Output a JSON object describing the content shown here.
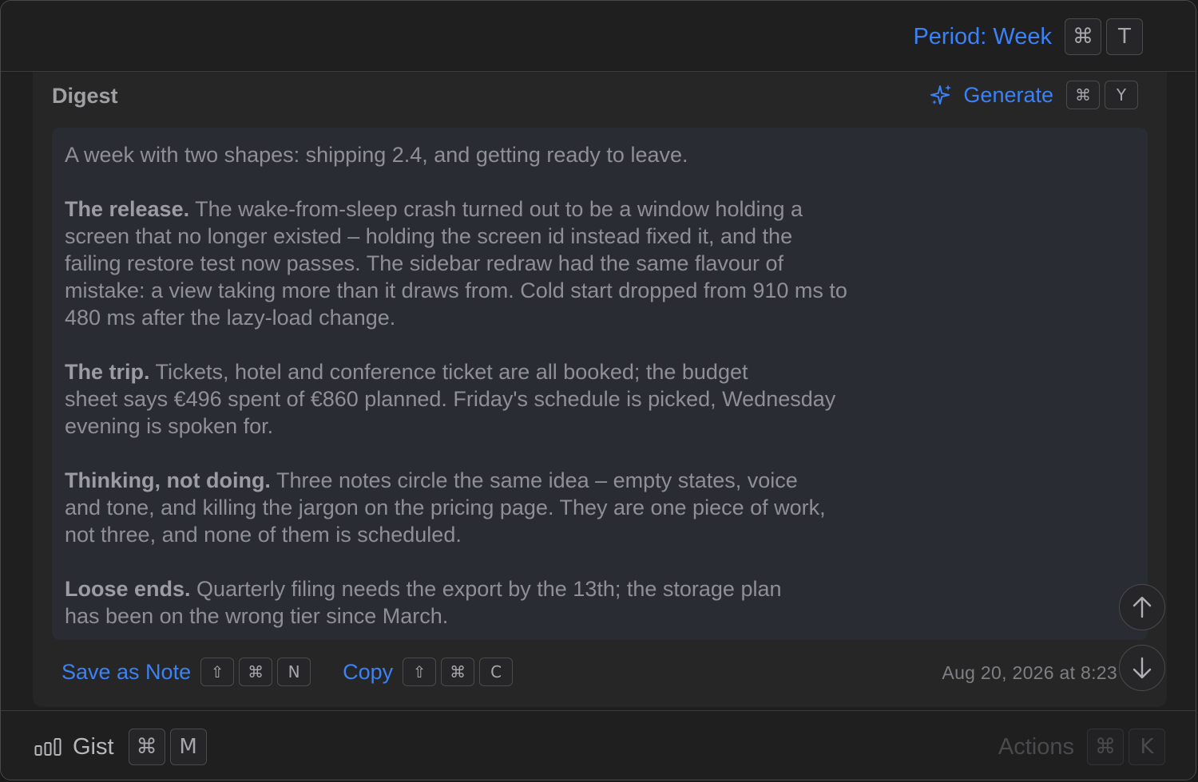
{
  "header": {
    "period_label": "Period: Week",
    "period_keys": [
      "⌘",
      "T"
    ]
  },
  "digest": {
    "title": "Digest",
    "generate_label": "Generate",
    "generate_keys": [
      "⌘",
      "Y"
    ],
    "intro": "A week with two shapes: shipping 2.4, and getting ready to leave.",
    "sections": [
      {
        "heading": "The release.",
        "lines": [
          "The wake-from-sleep crash turned out to be a window holding a",
          "screen that no longer existed – holding the screen id instead fixed it, and the",
          "failing restore test now passes. The sidebar redraw had the same flavour of",
          "mistake: a view taking more than it draws from. Cold start dropped from 910 ms to",
          "480 ms after the lazy-load change."
        ]
      },
      {
        "heading": "The trip.",
        "lines": [
          "Tickets, hotel and conference ticket are all booked; the budget",
          "sheet says €496 spent of €860 planned. Friday's schedule is picked, Wednesday",
          "evening is spoken for."
        ]
      },
      {
        "heading": "Thinking, not doing.",
        "lines": [
          "Three notes circle the same idea – empty states, voice",
          "and tone, and killing the jargon on the pricing page. They are one piece of work,",
          "not three, and none of them is scheduled."
        ]
      },
      {
        "heading": "Loose ends.",
        "lines": [
          "Quarterly filing needs the export by the 13th; the storage plan",
          "has been on the wrong tier since March."
        ]
      }
    ],
    "save_label": "Save as Note",
    "save_keys": [
      "⇧",
      "⌘",
      "N"
    ],
    "copy_label": "Copy",
    "copy_keys": [
      "⇧",
      "⌘",
      "C"
    ],
    "timestamp": "Aug 20, 2026 at 8:23"
  },
  "bottom": {
    "gist_label": "Gist",
    "gist_keys": [
      "⌘",
      "M"
    ],
    "actions_label": "Actions",
    "actions_keys": [
      "⌘",
      "K"
    ]
  },
  "icons": {
    "accent": "#3b82f6",
    "generate": "sparkles-icon",
    "scroll_up": "arrow-up-icon",
    "scroll_down": "arrow-down-icon",
    "app": "bar-chart-icon"
  }
}
